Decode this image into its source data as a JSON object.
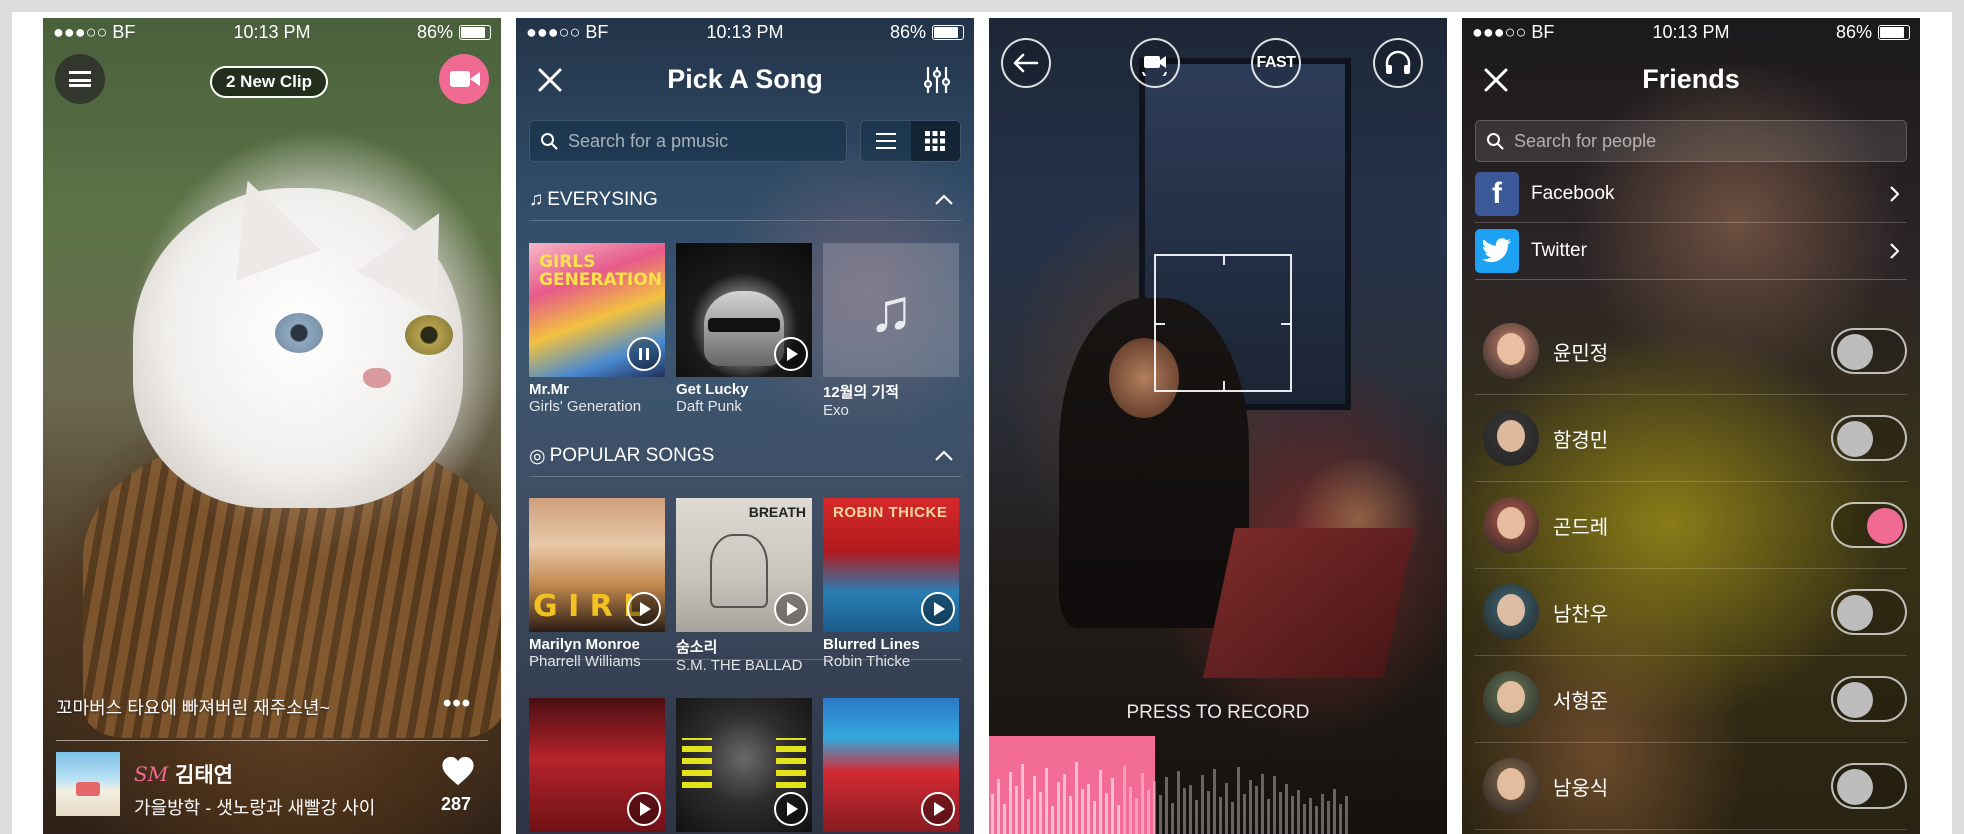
{
  "screen1": {
    "status": {
      "carrier": "●●●○○ BF",
      "time": "10:13 PM",
      "battery": "86%"
    },
    "new_clip_label": "2 New Clip",
    "caption": "꼬마버스 타요에 빠져버린 재주소년~",
    "more": "•••",
    "artist": "김태연",
    "label_logo": "SM",
    "song": "가을방학 - 샛노랑과 새빨강 사이",
    "likes": "287",
    "accent_color": "#f06a93"
  },
  "screen2": {
    "status": {
      "carrier": "●●●○○ BF",
      "time": "10:13 PM",
      "battery": "86%"
    },
    "title": "Pick A Song",
    "search_placeholder": "Search for a pmusic",
    "section1": "EVERYSING",
    "section2": "POPULAR SONGS",
    "everysing": [
      {
        "title": "Mr.Mr",
        "artist": "Girls' Generation",
        "state": "playing"
      },
      {
        "title": "Get Lucky",
        "artist": "Daft Punk",
        "state": "paused"
      },
      {
        "title": "12월의 기적",
        "artist": "Exo",
        "state": "no-art"
      }
    ],
    "popular": [
      {
        "title": "Marilyn Monroe",
        "artist": "Pharrell Williams"
      },
      {
        "title": "숨소리",
        "artist": "S.M. THE BALLAD"
      },
      {
        "title": "Blurred Lines",
        "artist": "Robin Thicke"
      }
    ]
  },
  "screen3": {
    "fast_label": "FAST",
    "press_label": "PRESS TO RECORD",
    "progress": 0.36
  },
  "screen4": {
    "status": {
      "carrier": "●●●○○ BF",
      "time": "10:13 PM",
      "battery": "86%"
    },
    "title": "Friends",
    "search_placeholder": "Search for people",
    "social": [
      {
        "name": "Facebook",
        "logo": "f"
      },
      {
        "name": "Twitter",
        "logo": "twitter-bird"
      }
    ],
    "friends": [
      {
        "name": "윤민정",
        "on": false
      },
      {
        "name": "함경민",
        "on": false
      },
      {
        "name": "곤드레",
        "on": true
      },
      {
        "name": "남찬우",
        "on": false
      },
      {
        "name": "서형준",
        "on": false
      },
      {
        "name": "남웅식",
        "on": false
      }
    ]
  }
}
